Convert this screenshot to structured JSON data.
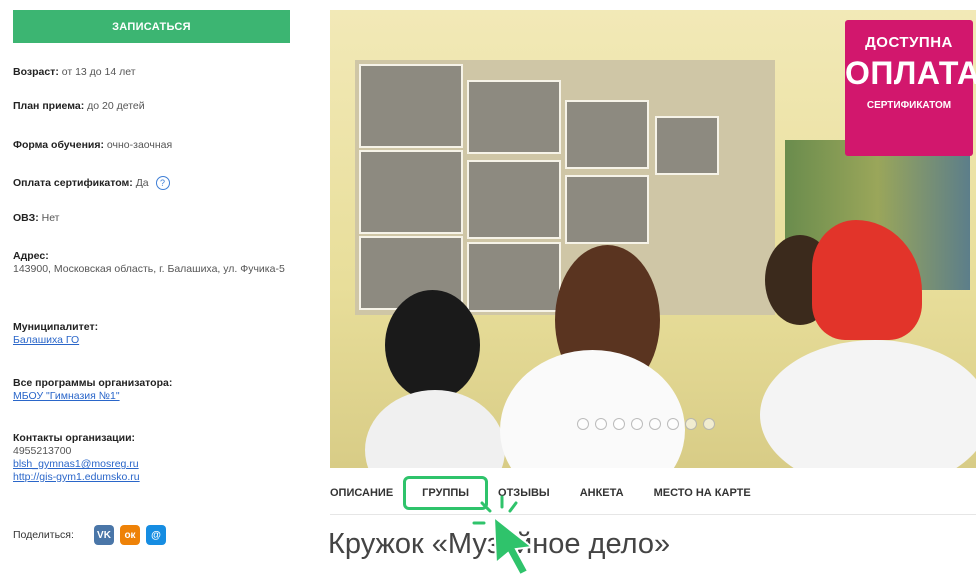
{
  "sidebar": {
    "enroll_label": "ЗАПИСАТЬСЯ",
    "age_label": "Возраст:",
    "age_value": "от 13 до 14 лет",
    "plan_label": "План приема:",
    "plan_value": "до 20 детей",
    "form_label": "Форма обучения:",
    "form_value": "очно-заочная",
    "payment_label": "Оплата сертификатом:",
    "payment_value": "Да",
    "ovz_label": "ОВЗ:",
    "ovz_value": "Нет",
    "address_label": "Адрес:",
    "address_value": "143900, Московская область, г. Балашиха, ул. Фучика-5",
    "municipality_label": "Муниципалитет:",
    "municipality_value": "Балашиха ГО",
    "programs_label": "Все программы организатора:",
    "programs_value": "МБОУ \"Гимназия №1\"",
    "contacts_label": "Контакты организации:",
    "contacts_phone": "4955213700",
    "contacts_email": "blsh_gymnas1@mosreg.ru",
    "contacts_site": "http://gis-gym1.edumsko.ru",
    "share_label": "Поделиться:",
    "share_icons": [
      "vk-icon",
      "odnoklassniki-icon",
      "mail-icon"
    ]
  },
  "hero": {
    "badge_line1": "ДОСТУПНА",
    "badge_line2": "ОПЛАТА",
    "badge_line3": "СЕРТИФИКАТОМ",
    "slides_total": 8,
    "slide_active": 3
  },
  "tabs": [
    "ОПИСАНИЕ",
    "ГРУППЫ",
    "ОТЗЫВЫ",
    "АНКЕТА",
    "МЕСТО НА КАРТЕ"
  ],
  "tab_active_index": 1,
  "page_title": "Кружок «Музейное дело»",
  "colors": {
    "accent": "#3cb572",
    "badge": "#d2176d",
    "link": "#2a66c9",
    "highlight": "#2fc36b"
  }
}
